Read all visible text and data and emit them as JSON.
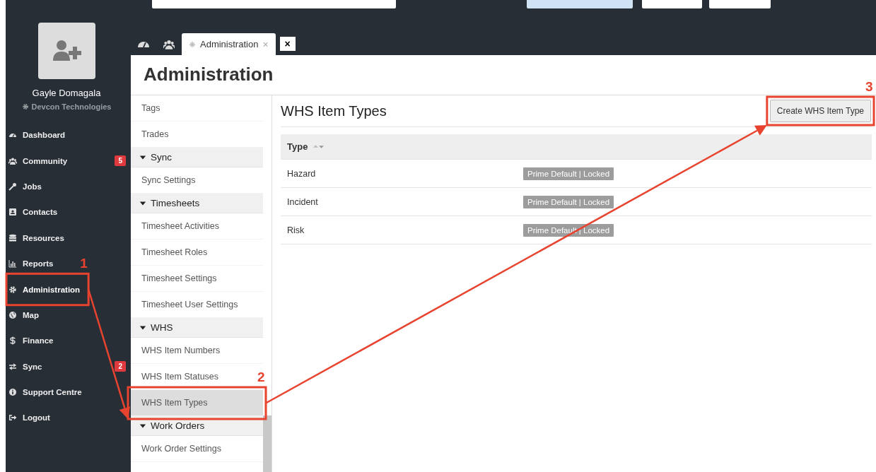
{
  "tabs": [
    {
      "kind": "dashboard",
      "selected": false
    },
    {
      "kind": "community",
      "selected": false
    },
    {
      "kind": "page",
      "label": "Administration",
      "close": "×",
      "selected": true
    }
  ],
  "close_all_tabs": "×",
  "user": {
    "name": "Gayle Domagala",
    "company": "Devcon Technologies"
  },
  "sidebar": {
    "items": [
      {
        "label": "Dashboard",
        "selected": false
      },
      {
        "label": "Community",
        "badge": "5",
        "selected": false
      },
      {
        "label": "Jobs",
        "selected": false
      },
      {
        "label": "Contacts",
        "selected": false
      },
      {
        "label": "Resources",
        "selected": false
      },
      {
        "label": "Reports",
        "selected": false
      },
      {
        "label": "Administration",
        "selected": true
      },
      {
        "label": "Map",
        "selected": false
      },
      {
        "label": "Finance",
        "selected": false
      },
      {
        "label": "Sync",
        "badge": "2",
        "selected": false
      },
      {
        "label": "Support Centre",
        "selected": false
      },
      {
        "label": "Logout",
        "selected": false
      }
    ]
  },
  "page_title": "Administration",
  "submenu": [
    {
      "kind": "item",
      "label": "Tags",
      "selected": false
    },
    {
      "kind": "item",
      "label": "Trades",
      "selected": false
    },
    {
      "kind": "section",
      "label": "Sync",
      "expanded": true
    },
    {
      "kind": "item",
      "label": "Sync Settings",
      "selected": false
    },
    {
      "kind": "section",
      "label": "Timesheets",
      "expanded": true
    },
    {
      "kind": "item",
      "label": "Timesheet Activities",
      "selected": false
    },
    {
      "kind": "item",
      "label": "Timesheet Roles",
      "selected": false
    },
    {
      "kind": "item",
      "label": "Timesheet Settings",
      "selected": false
    },
    {
      "kind": "item",
      "label": "Timesheet User Settings",
      "selected": false
    },
    {
      "kind": "section",
      "label": "WHS",
      "expanded": true
    },
    {
      "kind": "item",
      "label": "WHS Item Numbers",
      "selected": false
    },
    {
      "kind": "item",
      "label": "WHS Item Statuses",
      "selected": false
    },
    {
      "kind": "item",
      "label": "WHS Item Types",
      "selected": true
    },
    {
      "kind": "section",
      "label": "Work Orders",
      "expanded": true
    },
    {
      "kind": "item",
      "label": "Work Order Settings",
      "selected": false
    }
  ],
  "panel": {
    "title": "WHS Item Types",
    "create_button": "Create WHS Item Type",
    "table": {
      "columns": [
        "Type"
      ],
      "rows": [
        {
          "type": "Hazard",
          "tag": "Prime Default | Locked"
        },
        {
          "type": "Incident",
          "tag": "Prime Default | Locked"
        },
        {
          "type": "Risk",
          "tag": "Prime Default | Locked"
        }
      ]
    }
  },
  "annotations": [
    {
      "number": "1"
    },
    {
      "number": "2"
    },
    {
      "number": "3"
    }
  ]
}
